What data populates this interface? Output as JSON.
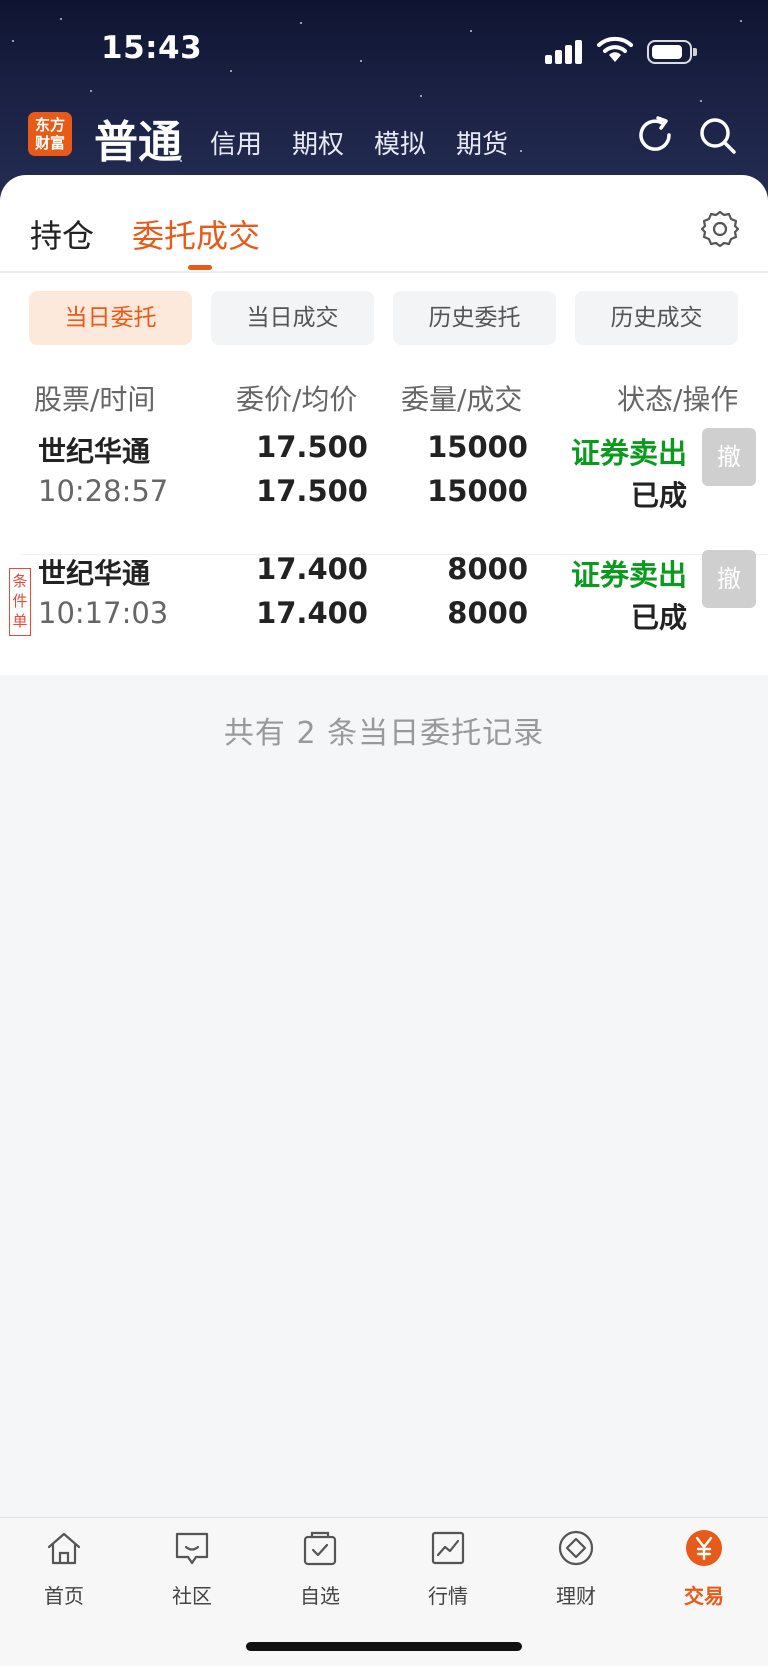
{
  "status_bar": {
    "time": "15:43"
  },
  "header": {
    "logo_text_line1": "东方",
    "logo_text_line2": "财富",
    "account_tabs": [
      "普通",
      "信用",
      "期权",
      "模拟",
      "期货"
    ],
    "icons": [
      "refresh-icon",
      "search-icon"
    ]
  },
  "main_tabs": [
    "持仓",
    "委托成交"
  ],
  "active_main_tab": "委托成交",
  "sub_tabs": [
    "当日委托",
    "当日成交",
    "历史委托",
    "历史成交"
  ],
  "active_sub_tab": "当日委托",
  "columns": [
    "股票/时间",
    "委价/均价",
    "委量/成交",
    "状态/操作"
  ],
  "orders": [
    {
      "name": "世纪华通",
      "time": "10:28:57",
      "order_price": "17.500",
      "avg_price": "17.500",
      "order_qty": "15000",
      "filled_qty": "15000",
      "action": "证券卖出",
      "status": "已成",
      "cancel_label": "撤",
      "tag": ""
    },
    {
      "name": "世纪华通",
      "time": "10:17:03",
      "order_price": "17.400",
      "avg_price": "17.400",
      "order_qty": "8000",
      "filled_qty": "8000",
      "action": "证券卖出",
      "status": "已成",
      "cancel_label": "撤",
      "tag": "条件单"
    }
  ],
  "summary": "共有 2 条当日委托记录",
  "bottom_nav": [
    {
      "label": "首页",
      "icon": "home-icon"
    },
    {
      "label": "社区",
      "icon": "chat-icon"
    },
    {
      "label": "自选",
      "icon": "checkbag-icon"
    },
    {
      "label": "行情",
      "icon": "chart-icon"
    },
    {
      "label": "理财",
      "icon": "diamond-icon"
    },
    {
      "label": "交易",
      "icon": "yuan-icon"
    }
  ],
  "active_nav": "交易",
  "colors": {
    "accent": "#e85a17",
    "sell_green": "#0a9a1e"
  }
}
